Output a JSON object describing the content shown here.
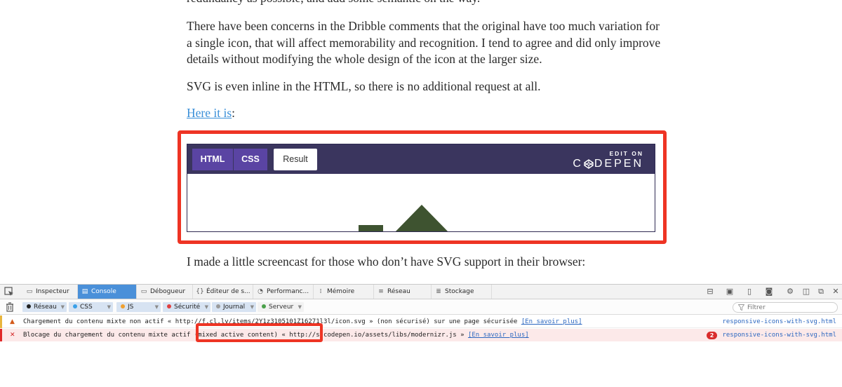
{
  "article": {
    "p_top": "redundancy as possible, and add some semantic on the way.",
    "p_concern_lines": [
      "There have been concerns in the Dribble comments that the original have too much variation for",
      "a single icon, that will affect memorability and recognition. I tend to agree and did only improve",
      "details without modifying the whole design of the icon at the larger size."
    ],
    "p_svg": "SVG is even inline in the HTML, so there is no additional request at all.",
    "here_link": "Here it is",
    "here_suffix": ":",
    "p_screencast": "I made a little screencast for those who don’t have SVG support in their browser:"
  },
  "codepen": {
    "tabs": [
      "HTML",
      "CSS",
      "Result"
    ],
    "active_tab": "Result",
    "edit_on": "EDIT ON",
    "brand_left": "C",
    "brand_right": "DEPEN",
    "shape_color": "#3e5330"
  },
  "devtools": {
    "tabs": [
      {
        "label": "Inspecteur"
      },
      {
        "label": "Console"
      },
      {
        "label": "Débogueur"
      },
      {
        "label": "Éditeur de s..."
      },
      {
        "label": "Performanc..."
      },
      {
        "label": "Mémoire"
      },
      {
        "label": "Réseau"
      },
      {
        "label": "Stockage"
      }
    ],
    "active_tab": "Console",
    "filters": [
      {
        "label": "Réseau",
        "dot": "#222222",
        "on": true
      },
      {
        "label": "CSS",
        "dot": "#3aa0e8",
        "on": true
      },
      {
        "label": "JS",
        "dot": "#f0a030",
        "on": true
      },
      {
        "label": "Sécurité",
        "dot": "#e04040",
        "on": true
      },
      {
        "label": "Journal",
        "dot": "#9a9a9a",
        "on": true
      },
      {
        "label": "Serveur",
        "dot": "#4aa04a",
        "on": false
      }
    ],
    "filter_placeholder": "Filtrer",
    "messages": [
      {
        "type": "warning",
        "text": "Chargement du contenu mixte non actif « http://f.cl.ly/items/2Y1z3105101Z16271l3l/icon.svg » (non sécurisé) sur une page sécurisée",
        "link": "[En savoir plus]",
        "source": "responsive-icons-with-svg.html"
      },
      {
        "type": "error",
        "text": "Blocage du chargement du contenu mixte actif (mixed active content) « http://s.codepen.io/assets/libs/modernizr.js »",
        "link": "[En savoir plus]",
        "count": "2",
        "source": "responsive-icons-with-svg.html"
      }
    ]
  }
}
